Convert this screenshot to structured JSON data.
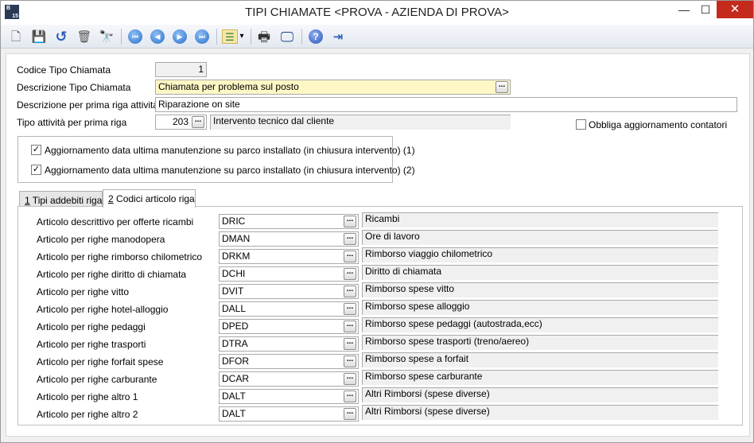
{
  "window": {
    "title": "TIPI CHIAMATE <PROVA - AZIENDA DI PROVA>",
    "app_icon_text": "B",
    "app_icon_sub": "15",
    "minimize_symbol": "—",
    "maximize_symbol": "☐",
    "close_symbol": "✕"
  },
  "toolbar": {
    "icons": [
      "new-document-icon",
      "save-icon",
      "undo-icon",
      "delete-icon",
      "search-binoculars-icon",
      "first-record-icon",
      "previous-record-icon",
      "next-record-icon",
      "last-record-icon",
      "list-options-icon",
      "print-icon",
      "preview-monitor-icon",
      "help-icon",
      "exit-icon"
    ],
    "symbols": {
      "new": "🗋",
      "save": "💾",
      "undo": "↺",
      "delete": "🗑",
      "search": "🔭",
      "first": "⏮",
      "prev": "◀",
      "next": "▶",
      "last": "⏭",
      "list": "☰",
      "dropdown": "▾",
      "print": "🖶",
      "preview": "🖵",
      "help": "?",
      "exit": "⇥"
    }
  },
  "form": {
    "codice_label": "Codice Tipo Chiamata",
    "codice_value": "1",
    "descrizione_label": "Descrizione Tipo Chiamata",
    "descrizione_value": "Chiamata per problema sul posto",
    "descr_prima_riga_label": "Descrizione per prima riga attività",
    "descr_prima_riga_value": "Riparazione on site",
    "tipo_attivita_label": "Tipo attività per prima riga",
    "tipo_attivita_code": "203",
    "tipo_attivita_desc": "Intervento tecnico dal cliente",
    "obbliga_label": "Obbliga aggiornamento contatori",
    "obbliga_checked": false,
    "ellipsis": "..."
  },
  "checkboxes": [
    {
      "label": "Aggiornamento data ultima manutenzione su parco installato (in chiusura intervento)  (1)",
      "checked": true,
      "mark": "✓"
    },
    {
      "label": "Aggiornamento data ultima manutenzione su parco installato (in chiusura intervento)  (2)",
      "checked": true,
      "mark": "✓"
    }
  ],
  "tabs": [
    {
      "key": "1",
      "label": " Tipi addebiti riga",
      "active": false
    },
    {
      "key": "2",
      "label": " Codici articolo riga",
      "active": true
    }
  ],
  "articoli": [
    {
      "label": "Articolo descrittivo per offerte ricambi",
      "code": "DRIC",
      "desc": "Ricambi"
    },
    {
      "label": "Articolo per righe manodopera",
      "code": "DMAN",
      "desc": "Ore di lavoro"
    },
    {
      "label": "Articolo per righe rimborso chilometrico",
      "code": "DRKM",
      "desc": "Rimborso viaggio chilometrico"
    },
    {
      "label": "Articolo per righe diritto di chiamata",
      "code": "DCHI",
      "desc": "Diritto di chiamata"
    },
    {
      "label": "Articolo per righe vitto",
      "code": "DVIT",
      "desc": "Rimborso spese vitto"
    },
    {
      "label": "Articolo per righe hotel-alloggio",
      "code": "DALL",
      "desc": "Rimborso spese alloggio"
    },
    {
      "label": "Articolo per righe pedaggi",
      "code": "DPED",
      "desc": "Rimborso spese pedaggi (autostrada,ecc)"
    },
    {
      "label": "Articolo per righe trasporti",
      "code": "DTRA",
      "desc": "Rimborso spese trasporti (treno/aereo)"
    },
    {
      "label": "Articolo per righe forfait spese",
      "code": "DFOR",
      "desc": "Rimborso spese a forfait"
    },
    {
      "label": "Articolo per righe carburante",
      "code": "DCAR",
      "desc": "Rimborso spese carburante"
    },
    {
      "label": "Articolo per righe altro 1",
      "code": "DALT",
      "desc": "Altri Rimborsi (spese  diverse)"
    },
    {
      "label": "Articolo per righe altro 2",
      "code": "DALT",
      "desc": "Altri Rimborsi (spese  diverse)"
    }
  ]
}
